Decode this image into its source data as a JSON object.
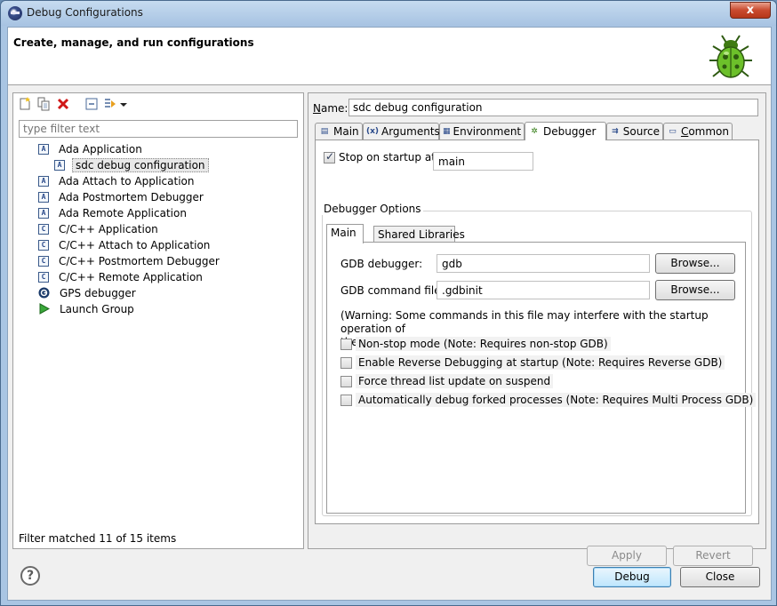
{
  "window": {
    "title": "Debug Configurations",
    "close_glyph": "x"
  },
  "header": {
    "title": "Create, manage, and run configurations",
    "icon": "bug-icon"
  },
  "left": {
    "filter_placeholder": "type filter text",
    "items": [
      {
        "label": "Ada Application",
        "icon": "A",
        "level": 0,
        "selected": false
      },
      {
        "label": "sdc debug configuration",
        "icon": "A",
        "level": 1,
        "selected": true
      },
      {
        "label": "Ada Attach to Application",
        "icon": "A",
        "level": 0,
        "selected": false
      },
      {
        "label": "Ada Postmortem Debugger",
        "icon": "A",
        "level": 0,
        "selected": false
      },
      {
        "label": "Ada Remote Application",
        "icon": "A",
        "level": 0,
        "selected": false
      },
      {
        "label": "C/C++ Application",
        "icon": "C",
        "level": 0,
        "selected": false
      },
      {
        "label": "C/C++ Attach to Application",
        "icon": "C",
        "level": 0,
        "selected": false
      },
      {
        "label": "C/C++ Postmortem Debugger",
        "icon": "C",
        "level": 0,
        "selected": false
      },
      {
        "label": "C/C++ Remote Application",
        "icon": "C",
        "level": 0,
        "selected": false
      },
      {
        "label": "GPS debugger",
        "icon": "gps-icon",
        "level": 0,
        "selected": false
      },
      {
        "label": "Launch Group",
        "icon": "play-icon",
        "level": 0,
        "selected": false
      }
    ],
    "status": "Filter matched 11 of 15 items"
  },
  "right": {
    "name_label": "Name:",
    "name_value": "sdc debug configuration",
    "tabs": [
      {
        "label": "Main",
        "icon": "main-tab-icon"
      },
      {
        "label": "Arguments",
        "icon": "arguments-tab-icon"
      },
      {
        "label": "Environment",
        "icon": "environment-tab-icon"
      },
      {
        "label": "Debugger",
        "icon": "debugger-tab-icon"
      },
      {
        "label": "Source",
        "icon": "source-tab-icon"
      },
      {
        "label": "Common",
        "icon": "common-tab-icon"
      }
    ],
    "active_tab": "Debugger",
    "stop_on_startup": {
      "label": "Stop on startup at:",
      "checked": true,
      "value": "main"
    },
    "options_group": {
      "label": "Debugger Options",
      "tabs": [
        "Main",
        "Shared Libraries"
      ],
      "gdb_debugger": {
        "label": "GDB debugger:",
        "value": "gdb",
        "button": "Browse..."
      },
      "gdb_command_file": {
        "label": "GDB command file:",
        "value": ".gdbinit",
        "button": "Browse..."
      },
      "warning_line1": "(Warning: Some commands in this file may interfere with the startup operation of",
      "warning_line2": "the debugger, for example \"run\".)",
      "options": [
        {
          "label": "Non-stop mode (Note: Requires non-stop GDB)",
          "checked": false
        },
        {
          "label": "Enable Reverse Debugging at startup (Note: Requires Reverse GDB)",
          "checked": false
        },
        {
          "label": "Force thread list update on suspend",
          "checked": false
        },
        {
          "label": "Automatically debug forked processes (Note: Requires Multi Process GDB)",
          "checked": false
        }
      ]
    },
    "apply_label": "Apply",
    "revert_label": "Revert"
  },
  "footer": {
    "debug_label": "Debug",
    "close_label": "Close",
    "help_glyph": "?"
  }
}
